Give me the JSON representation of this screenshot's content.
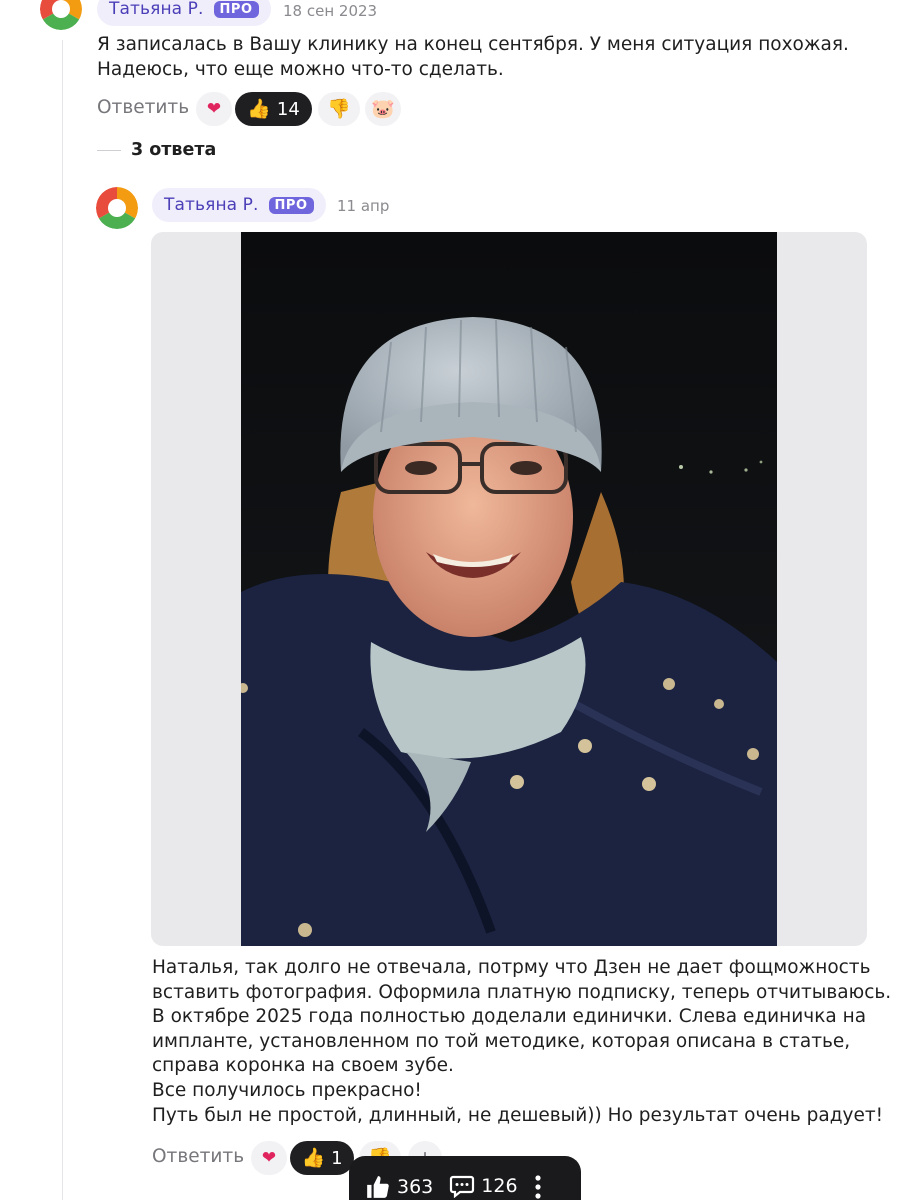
{
  "comment": {
    "author": "Татьяна Р.",
    "badge": "ПРО",
    "date": "18 сен 2023",
    "text_lines": [
      "Я записалась в Вашу клинику на конец сентября. У меня ситуация похожая.",
      "Надеюсь, что еще можно что-то сделать."
    ],
    "reply_label": "Ответить",
    "reactions": [
      {
        "icon": "heart-face-emoji",
        "glyph": "❤"
      },
      {
        "icon": "thumbs-up-emoji",
        "glyph": "👍",
        "count": "14"
      },
      {
        "icon": "thumbs-down-emoji",
        "glyph": "👎"
      },
      {
        "icon": "pig-emoji",
        "glyph": "🐷"
      }
    ]
  },
  "replies_toggle": {
    "label": "3 ответа"
  },
  "reply": {
    "author": "Татьяна Р.",
    "badge": "ПРО",
    "date": "11 апр",
    "text_lines": [
      "Наталья, так долго не отвечала, потрму что Дзен не дает фощможность",
      "вставить фотография. Оформила платную подписку, теперь отчитываюсь.",
      "В октябре 2025 года полностью доделали единички. Слева единичка на",
      "импланте, установленном по той методике, которая описана в статье,",
      "справа коронка на своем зубе.",
      "Все получилось прекрасно!",
      "Путь был не простой, длинный, не дешевый)) Но результат очень радует!"
    ],
    "reply_label": "Ответить",
    "reactions": [
      {
        "icon": "heart-face-emoji",
        "glyph": "❤"
      },
      {
        "icon": "thumbs-up-emoji",
        "glyph": "👍",
        "count": "1"
      },
      {
        "icon": "thumbs-down-emoji",
        "glyph": "👎"
      },
      {
        "icon": "add-reaction-icon",
        "glyph": "+"
      }
    ]
  },
  "bottom_bar": {
    "likes": "363",
    "comments": "126",
    "like_icon": "thumbs-up-icon",
    "comment_icon": "comment-icon",
    "more_icon": "more-vertical-icon"
  },
  "colors": {
    "accent": "#6f65dd",
    "author_pill": "#f0eefb",
    "author_text": "#4b3fb8",
    "dark_pill": "#1f1f22"
  }
}
